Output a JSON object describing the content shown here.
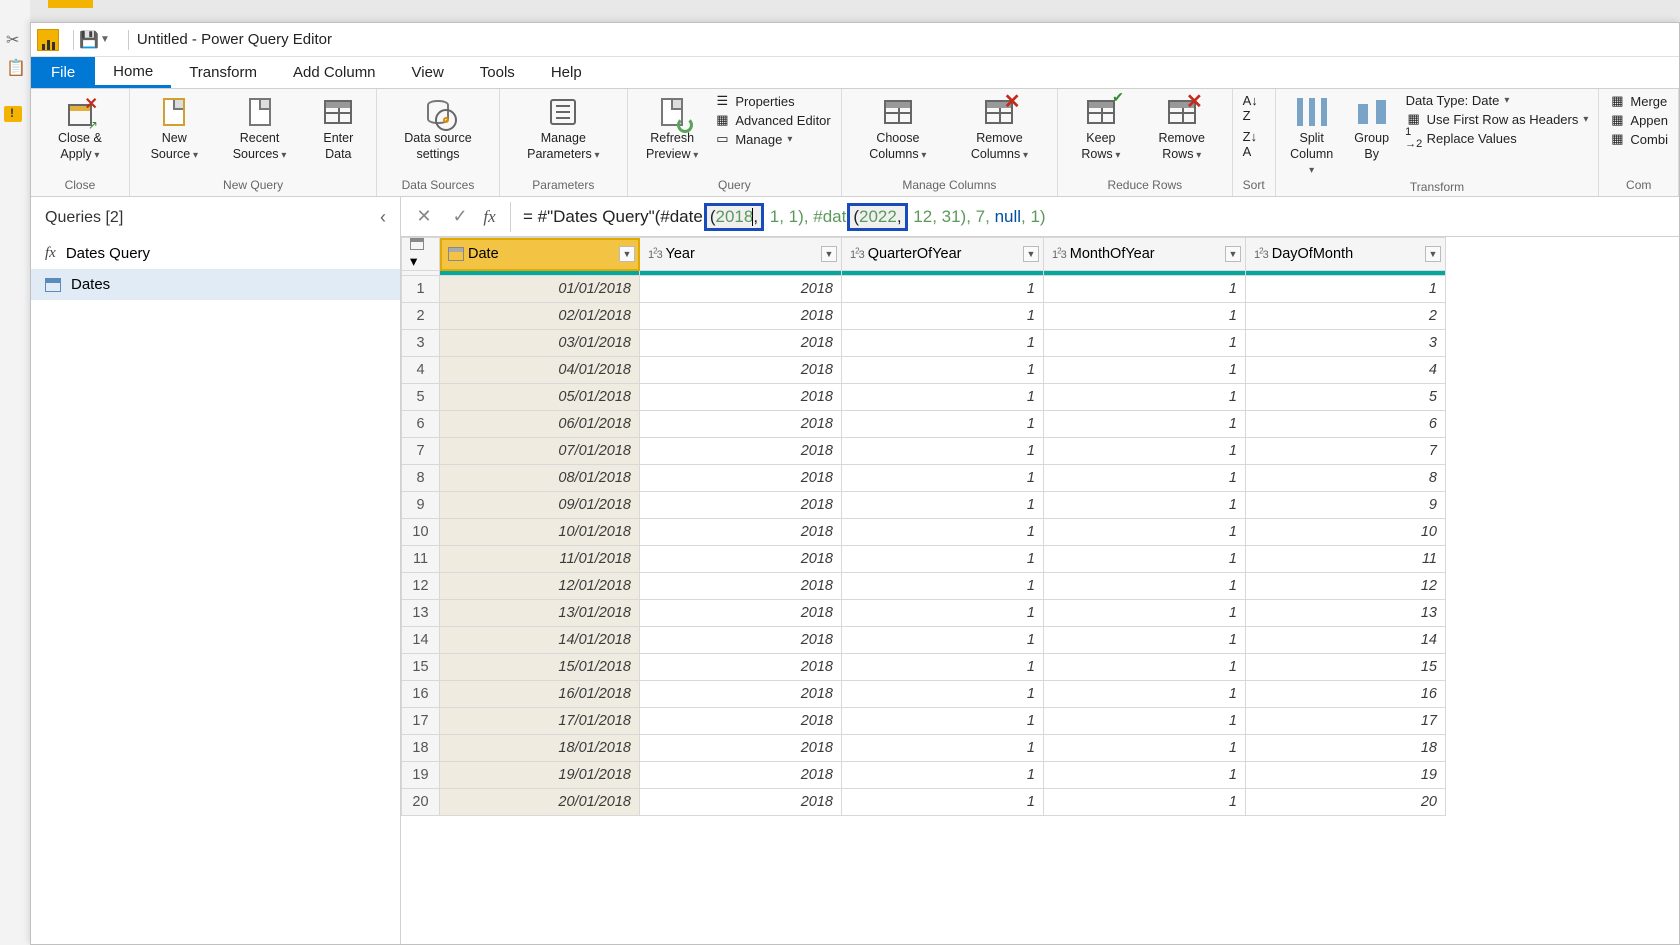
{
  "title": "Untitled - Power Query Editor",
  "tabs": {
    "file": "File",
    "home": "Home",
    "transform": "Transform",
    "addcol": "Add Column",
    "view": "View",
    "tools": "Tools",
    "help": "Help"
  },
  "ribbon": {
    "close": {
      "close_apply": "Close &\nApply",
      "group": "Close"
    },
    "newquery": {
      "new_source": "New\nSource",
      "recent": "Recent\nSources",
      "enter": "Enter\nData",
      "group": "New Query"
    },
    "datasources": {
      "settings": "Data source\nsettings",
      "group": "Data Sources"
    },
    "parameters": {
      "manage": "Manage\nParameters",
      "group": "Parameters"
    },
    "query": {
      "refresh": "Refresh\nPreview",
      "properties": "Properties",
      "advanced": "Advanced Editor",
      "manage": "Manage",
      "group": "Query"
    },
    "managecols": {
      "choose": "Choose\nColumns",
      "remove": "Remove\nColumns",
      "group": "Manage Columns"
    },
    "reducerows": {
      "keep": "Keep\nRows",
      "remove": "Remove\nRows",
      "group": "Reduce Rows"
    },
    "sort": {
      "group": "Sort"
    },
    "splitgroup": {
      "split": "Split\nColumn",
      "groupby": "Group\nBy"
    },
    "transform": {
      "datatype": "Data Type: Date",
      "firstrow": "Use First Row as Headers",
      "replace": "Replace Values",
      "group": "Transform"
    },
    "combine": {
      "merge": "Merge",
      "append": "Appen",
      "combine": "Combi",
      "group": "Com"
    }
  },
  "queries": {
    "header": "Queries [2]",
    "fn": "Dates Query",
    "tbl": "Dates"
  },
  "formula": {
    "pre": "= #\"Dates Query\"(#date",
    "box1_open": "(",
    "box1_val": "2018",
    "box1_close": ",",
    "mid1": " 1, 1), #dat",
    "box2_open": "(",
    "box2_val": "2022",
    "box2_close": ",",
    "mid2": " 12, 31), 7, ",
    "null": "null",
    "tail": ", 1)"
  },
  "columns": {
    "date": "Date",
    "year": "Year",
    "quarter": "QuarterOfYear",
    "month": "MonthOfYear",
    "day": "DayOfMonth"
  },
  "rows": [
    {
      "n": "1",
      "date": "01/01/2018",
      "year": "2018",
      "q": "1",
      "m": "1",
      "d": "1"
    },
    {
      "n": "2",
      "date": "02/01/2018",
      "year": "2018",
      "q": "1",
      "m": "1",
      "d": "2"
    },
    {
      "n": "3",
      "date": "03/01/2018",
      "year": "2018",
      "q": "1",
      "m": "1",
      "d": "3"
    },
    {
      "n": "4",
      "date": "04/01/2018",
      "year": "2018",
      "q": "1",
      "m": "1",
      "d": "4"
    },
    {
      "n": "5",
      "date": "05/01/2018",
      "year": "2018",
      "q": "1",
      "m": "1",
      "d": "5"
    },
    {
      "n": "6",
      "date": "06/01/2018",
      "year": "2018",
      "q": "1",
      "m": "1",
      "d": "6"
    },
    {
      "n": "7",
      "date": "07/01/2018",
      "year": "2018",
      "q": "1",
      "m": "1",
      "d": "7"
    },
    {
      "n": "8",
      "date": "08/01/2018",
      "year": "2018",
      "q": "1",
      "m": "1",
      "d": "8"
    },
    {
      "n": "9",
      "date": "09/01/2018",
      "year": "2018",
      "q": "1",
      "m": "1",
      "d": "9"
    },
    {
      "n": "10",
      "date": "10/01/2018",
      "year": "2018",
      "q": "1",
      "m": "1",
      "d": "10"
    },
    {
      "n": "11",
      "date": "11/01/2018",
      "year": "2018",
      "q": "1",
      "m": "1",
      "d": "11"
    },
    {
      "n": "12",
      "date": "12/01/2018",
      "year": "2018",
      "q": "1",
      "m": "1",
      "d": "12"
    },
    {
      "n": "13",
      "date": "13/01/2018",
      "year": "2018",
      "q": "1",
      "m": "1",
      "d": "13"
    },
    {
      "n": "14",
      "date": "14/01/2018",
      "year": "2018",
      "q": "1",
      "m": "1",
      "d": "14"
    },
    {
      "n": "15",
      "date": "15/01/2018",
      "year": "2018",
      "q": "1",
      "m": "1",
      "d": "15"
    },
    {
      "n": "16",
      "date": "16/01/2018",
      "year": "2018",
      "q": "1",
      "m": "1",
      "d": "16"
    },
    {
      "n": "17",
      "date": "17/01/2018",
      "year": "2018",
      "q": "1",
      "m": "1",
      "d": "17"
    },
    {
      "n": "18",
      "date": "18/01/2018",
      "year": "2018",
      "q": "1",
      "m": "1",
      "d": "18"
    },
    {
      "n": "19",
      "date": "19/01/2018",
      "year": "2018",
      "q": "1",
      "m": "1",
      "d": "19"
    },
    {
      "n": "20",
      "date": "20/01/2018",
      "year": "2018",
      "q": "1",
      "m": "1",
      "d": "20"
    }
  ]
}
